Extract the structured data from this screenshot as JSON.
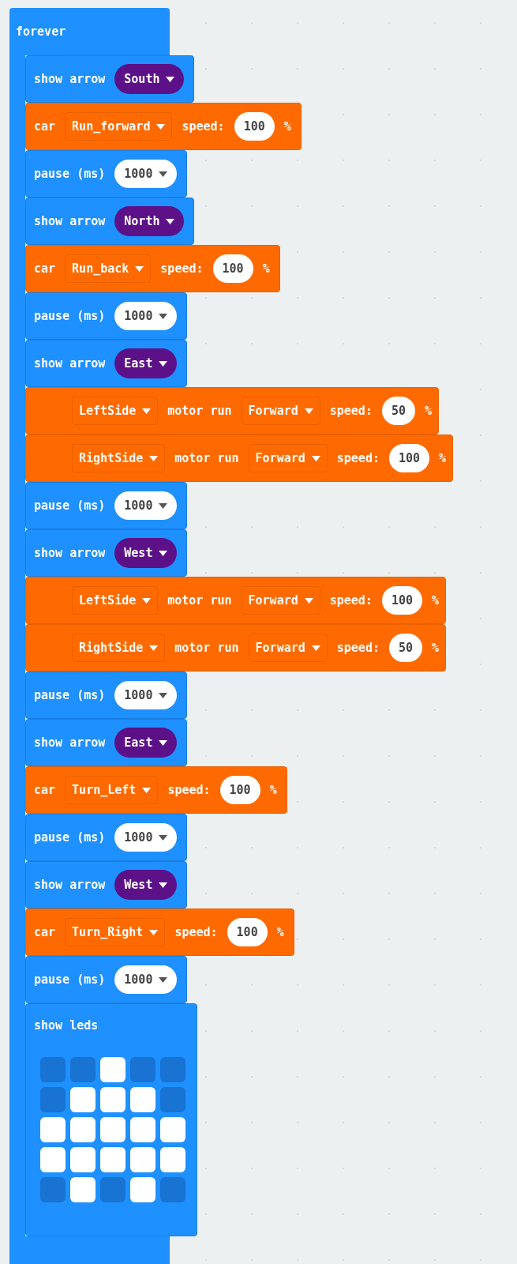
{
  "forever": {
    "label": "forever",
    "blocks": [
      {
        "kind": "show_arrow",
        "label": "show arrow",
        "direction": "South"
      },
      {
        "kind": "car",
        "label": "car",
        "action": "Run_forward",
        "speed_label": "speed:",
        "speed": "100",
        "unit": "%"
      },
      {
        "kind": "pause",
        "label": "pause (ms)",
        "value": "1000"
      },
      {
        "kind": "show_arrow",
        "label": "show arrow",
        "direction": "North"
      },
      {
        "kind": "car",
        "label": "car",
        "action": "Run_back",
        "speed_label": "speed:",
        "speed": "100",
        "unit": "%"
      },
      {
        "kind": "pause",
        "label": "pause (ms)",
        "value": "1000"
      },
      {
        "kind": "show_arrow",
        "label": "show arrow",
        "direction": "East"
      },
      {
        "kind": "motor",
        "side": "LeftSide",
        "label": "motor run",
        "direction": "Forward",
        "speed_label": "speed:",
        "speed": "50",
        "unit": "%"
      },
      {
        "kind": "motor",
        "side": "RightSide",
        "label": "motor run",
        "direction": "Forward",
        "speed_label": "speed:",
        "speed": "100",
        "unit": "%"
      },
      {
        "kind": "pause",
        "label": "pause (ms)",
        "value": "1000"
      },
      {
        "kind": "show_arrow",
        "label": "show arrow",
        "direction": "West"
      },
      {
        "kind": "motor",
        "side": "LeftSide",
        "label": "motor run",
        "direction": "Forward",
        "speed_label": "speed:",
        "speed": "100",
        "unit": "%"
      },
      {
        "kind": "motor",
        "side": "RightSide",
        "label": "motor run",
        "direction": "Forward",
        "speed_label": "speed:",
        "speed": "50",
        "unit": "%"
      },
      {
        "kind": "pause",
        "label": "pause (ms)",
        "value": "1000"
      },
      {
        "kind": "show_arrow",
        "label": "show arrow",
        "direction": "East"
      },
      {
        "kind": "car",
        "label": "car",
        "action": "Turn_Left",
        "speed_label": "speed:",
        "speed": "100",
        "unit": "%"
      },
      {
        "kind": "pause",
        "label": "pause (ms)",
        "value": "1000"
      },
      {
        "kind": "show_arrow",
        "label": "show arrow",
        "direction": "West"
      },
      {
        "kind": "car",
        "label": "car",
        "action": "Turn_Right",
        "speed_label": "speed:",
        "speed": "100",
        "unit": "%"
      },
      {
        "kind": "pause",
        "label": "pause (ms)",
        "value": "1000"
      },
      {
        "kind": "show_leds",
        "label": "show leds",
        "leds": [
          [
            {
              "on": false
            },
            {
              "on": false
            },
            {
              "on": true
            },
            {
              "on": false
            },
            {
              "on": false
            }
          ],
          [
            {
              "on": false
            },
            {
              "on": true
            },
            {
              "on": true
            },
            {
              "on": true
            },
            {
              "on": false
            }
          ],
          [
            {
              "on": true
            },
            {
              "on": true
            },
            {
              "on": true
            },
            {
              "on": true
            },
            {
              "on": true
            }
          ],
          [
            {
              "on": true
            },
            {
              "on": true
            },
            {
              "on": true
            },
            {
              "on": true
            },
            {
              "on": true
            }
          ],
          [
            {
              "on": false
            },
            {
              "on": true
            },
            {
              "on": false
            },
            {
              "on": true
            },
            {
              "on": false
            }
          ]
        ]
      }
    ]
  }
}
